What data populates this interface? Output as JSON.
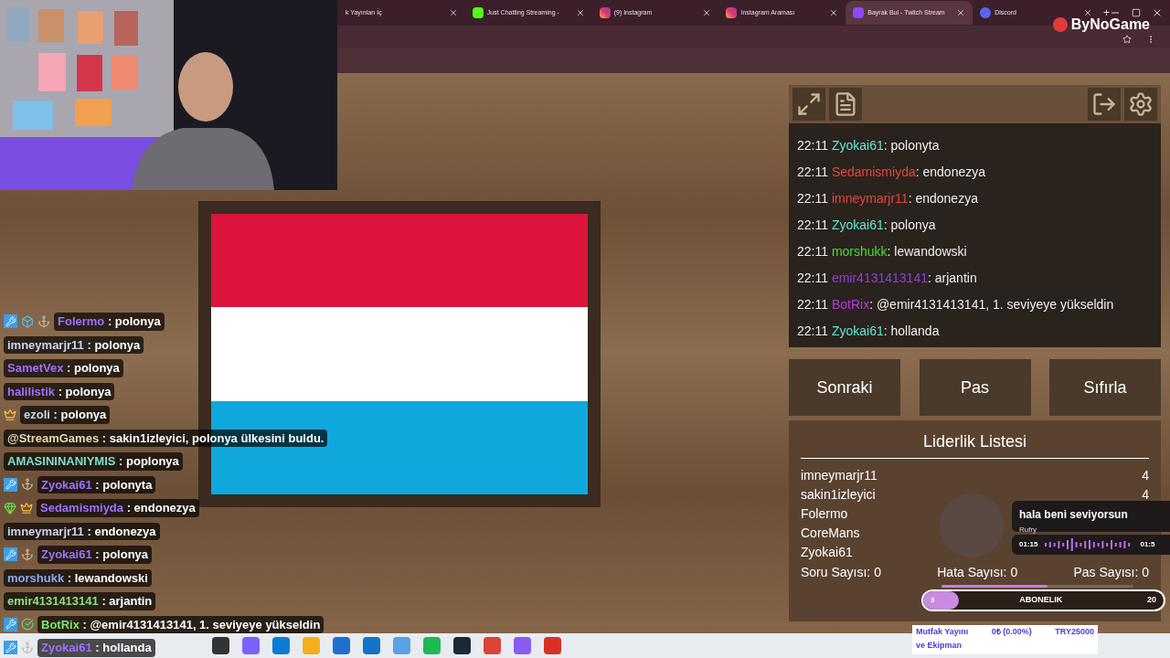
{
  "browser": {
    "tabs": [
      {
        "title": "k Yayınları İç",
        "kind": "plain",
        "selected": false
      },
      {
        "title": "Just Chatting Streaming -",
        "kind": "kick",
        "selected": false
      },
      {
        "title": "(9) Instagram",
        "kind": "instagram",
        "selected": false
      },
      {
        "title": "Instagram Araması",
        "kind": "instagram",
        "selected": false
      },
      {
        "title": "Bayrak Bul - Twitch Stream",
        "kind": "twitch",
        "selected": true
      },
      {
        "title": "Discord",
        "kind": "discord",
        "selected": false
      }
    ],
    "new_tab": "+"
  },
  "logo": {
    "text": "ByNoGame"
  },
  "flag": {
    "stripes": [
      {
        "color": "#dc143c"
      },
      {
        "color": "#ffffff"
      },
      {
        "color": "#10a8dc"
      }
    ]
  },
  "panel": {
    "chat": [
      {
        "time": "22:11",
        "name": "Zyokai61",
        "color": "#5eead4",
        "text": ": polonyta"
      },
      {
        "time": "22:11",
        "name": "Sedamismiyda",
        "color": "#e0483e",
        "text": ": endonezya"
      },
      {
        "time": "22:11",
        "name": "imneymarjr11",
        "color": "#e0483e",
        "text": ": endonezya"
      },
      {
        "time": "22:11",
        "name": "Zyokai61",
        "color": "#5eead4",
        "text": ": polonya"
      },
      {
        "time": "22:11",
        "name": "morshukk",
        "color": "#4ade3a",
        "text": ": lewandowski"
      },
      {
        "time": "22:11",
        "name": "emir4131413141",
        "color": "#8b3fd9",
        "text": ": arjantin"
      },
      {
        "time": "22:11",
        "name": "BotRix",
        "color": "#b03ce0",
        "text": ": @emir4131413141, 1. seviyeye yükseldin"
      },
      {
        "time": "22:11",
        "name": "Zyokai61",
        "color": "#5eead4",
        "text": ": hollanda"
      }
    ],
    "buttons": [
      "Sonraki",
      "Pas",
      "Sıfırla"
    ],
    "leaderboard": {
      "title": "Liderlik Listesi",
      "rows": [
        {
          "name": "imneymarjr11",
          "score": "4"
        },
        {
          "name": "sakin1izleyici",
          "score": "4"
        },
        {
          "name": "Folermo"
        },
        {
          "name": "CoreMans"
        },
        {
          "name": "Zyokai61"
        }
      ],
      "stats": [
        "Soru Sayısı: 0",
        "Hata Sayısı: 0",
        "Pas Sayısı: 0"
      ]
    }
  },
  "overlay_chat": [
    {
      "badges": [
        {
          "kind": "mod"
        },
        {
          "kind": "cube"
        },
        {
          "kind": "anchor"
        }
      ],
      "name": "Folermo",
      "color": "#a070ff",
      "text": " : polonya"
    },
    {
      "name": "imneymarjr11",
      "color": "#c8d4f0",
      "text": " : polonya"
    },
    {
      "name": "SametVex",
      "color": "#a070ff",
      "text": " : polonya"
    },
    {
      "name": "halilistik",
      "color": "#a070ff",
      "text": " : polonya"
    },
    {
      "badges": [
        {
          "kind": "crown"
        }
      ],
      "name": "ezoli",
      "color": "#c8d4f0",
      "text": " : polonya"
    },
    {
      "name": "@StreamGames",
      "color": "#e8d8b0",
      "text": " : sakin1izleyici, polonya ülkesini buldu."
    },
    {
      "name": "AMASININANIYMIS",
      "color": "#7ee0c8",
      "text": " : poplonya"
    },
    {
      "badges": [
        {
          "kind": "mod"
        },
        {
          "kind": "anchor"
        }
      ],
      "name": "Zyokai61",
      "color": "#a070ff",
      "text": " : polonyta"
    },
    {
      "badges": [
        {
          "kind": "gem"
        },
        {
          "kind": "crown"
        }
      ],
      "name": "Sedamismiyda",
      "color": "#a070ff",
      "text": " : endonezya"
    },
    {
      "name": "imneymarjr11",
      "color": "#c8d4f0",
      "text": " : endonezya"
    },
    {
      "badges": [
        {
          "kind": "mod"
        },
        {
          "kind": "anchor"
        }
      ],
      "name": "Zyokai61",
      "color": "#a070ff",
      "text": " : polonya"
    },
    {
      "name": "morshukk",
      "color": "#8aa8f0",
      "text": " : lewandowski"
    },
    {
      "name": "emir4131413141",
      "color": "#8ee07a",
      "text": " : arjantin"
    },
    {
      "badges": [
        {
          "kind": "mod"
        },
        {
          "kind": "verified"
        }
      ],
      "name": "BotRix",
      "color": "#7ee86a",
      "text": " : @emir4131413141, 1. seviyeye yükseldin"
    },
    {
      "badges": [
        {
          "kind": "mod"
        },
        {
          "kind": "anchor"
        }
      ],
      "name": "Zyokai61",
      "color": "#a070ff",
      "text": " : hollanda"
    }
  ],
  "music": {
    "title": "hala beni seviyorsun",
    "artist": "Rufry",
    "elapsed": "01:15",
    "total": "01:5",
    "level": 0.55
  },
  "subscription": {
    "current": "3",
    "label": "ABONELIK",
    "goal": "20",
    "level": 0.15
  },
  "donation": {
    "title_line1": "Mutfak Yayını",
    "title_line2": "ve Ekipman",
    "amount": "0₺ (0.00%)",
    "goal": "TRY25000"
  }
}
